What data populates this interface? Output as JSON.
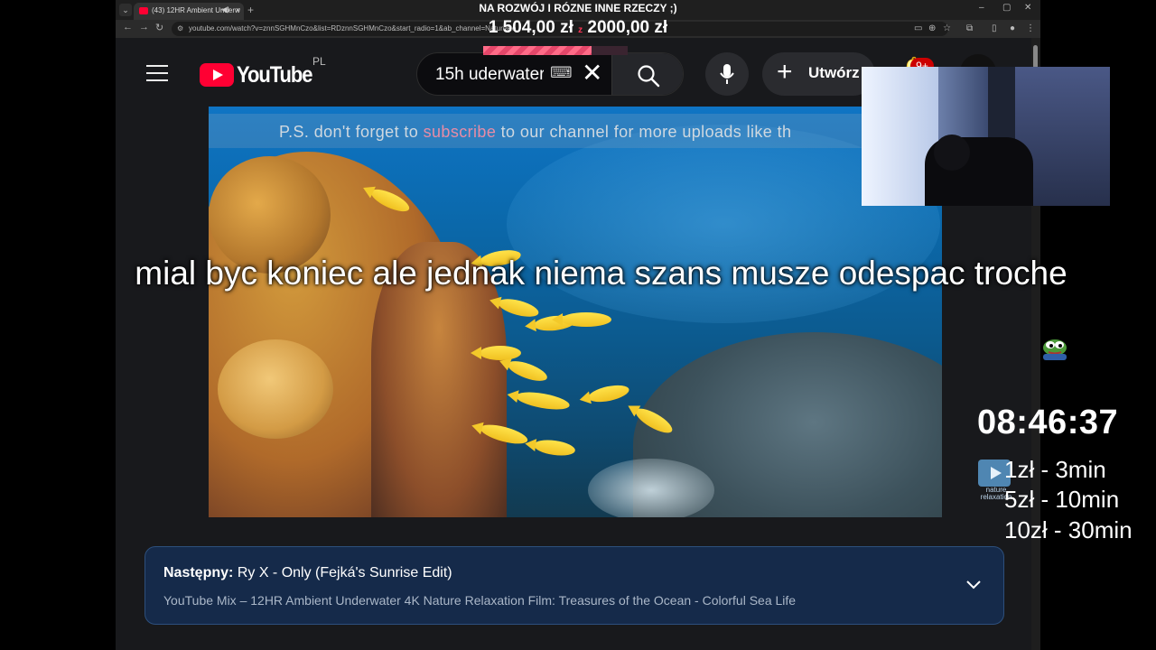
{
  "browser": {
    "tab_title": "(43) 12HR Ambient Underw",
    "tab_close": "×",
    "new_tab": "+",
    "url": "youtube.com/watch?v=znnSGHMnCzo&list=RDznnSGHMnCzo&start_radio=1&ab_channel=NatureRe"
  },
  "youtube": {
    "logo_text": "YouTube",
    "country_code": "PL",
    "search_value": "15h uderwater",
    "search_clear": "✕",
    "create_label": "Utwórz",
    "notification_badge": "9+"
  },
  "video": {
    "banner_prefix": "P.S. don't forget to ",
    "banner_highlight": "subscribe",
    "banner_suffix": " to our channel for more uploads like th"
  },
  "next_up": {
    "label": "Następny:",
    "title": "Ry X - Only (Fejká's Sunrise Edit)",
    "playlist": "YouTube Mix – 12HR Ambient Underwater 4K Nature Relaxation Film: Treasures of the Ocean - Colorful Sea Life"
  },
  "overlay": {
    "donation_title": "NA ROZWÓJ I RÓZNE INNE RZECZY ;)",
    "donation_current": "1 504,00 zł",
    "donation_separator": "z",
    "donation_goal": "2000,00 zł",
    "donation_progress_fraction": 0.752,
    "subtitle": "mial byc koniec ale jednak niema szans musze odespac troche",
    "timer": "08:46:37",
    "channel_logo_text": "nature relaxation",
    "prices": [
      "1zł - 3min",
      "5zł - 10min",
      "10zł - 30min"
    ]
  },
  "colors": {
    "youtube_red": "#ff0033",
    "next_card_bg": "#152a4a",
    "progress_fill": "#ff6b88"
  }
}
